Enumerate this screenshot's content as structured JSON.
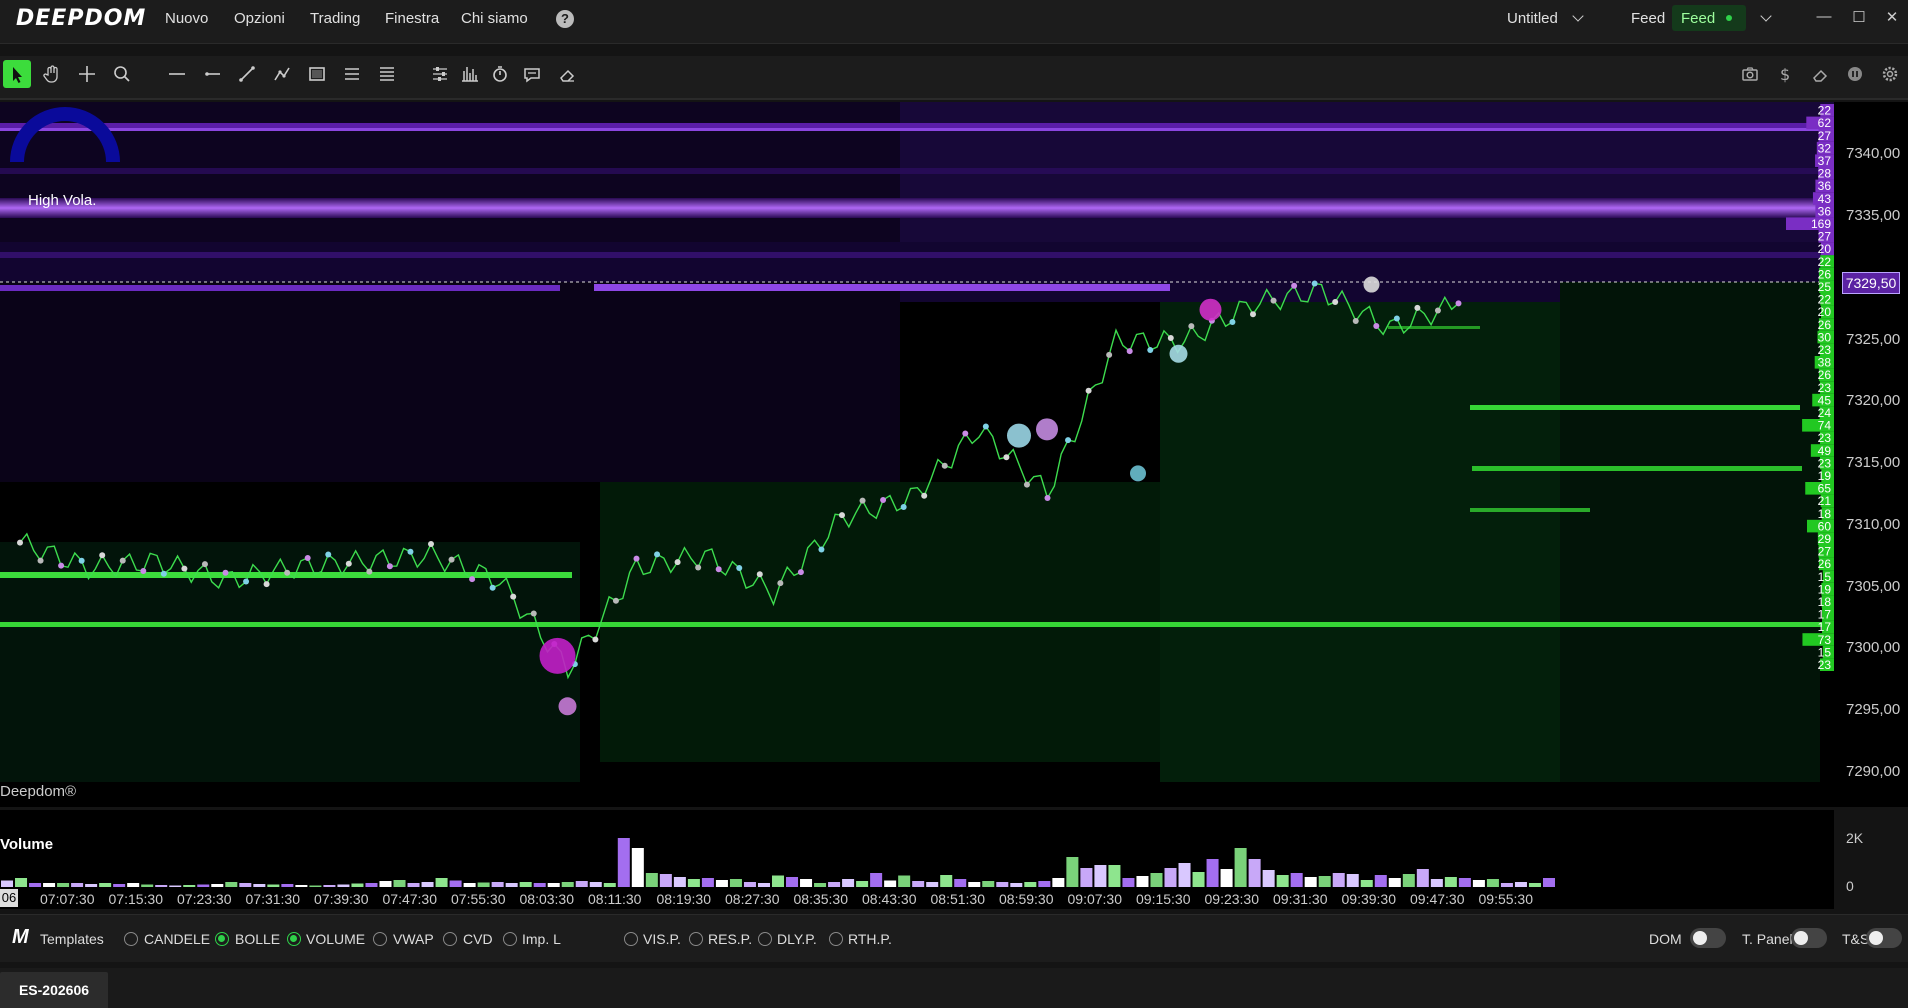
{
  "app": {
    "logo": "DEEPDOM"
  },
  "menu": {
    "items": [
      "Nuovo",
      "Opzioni",
      "Trading",
      "Finestra",
      "Chi siamo"
    ],
    "help": "?"
  },
  "header": {
    "workspace": "Untitled",
    "feed_label": "Feed",
    "feed_status": "Feed",
    "feed_status_color": "#2fd14a"
  },
  "window_controls": {
    "minimize": "—",
    "maximize": "☐",
    "close": "✕"
  },
  "toolbar": {
    "left_tools": [
      "pointer-icon",
      "hand-icon",
      "crosshair-icon",
      "magnifier-icon",
      "horizontal-line-icon",
      "horizontal-ray-icon",
      "trend-line-icon",
      "polyline-icon",
      "rectangle-icon",
      "parallel-lines-icon",
      "fib-lines-icon",
      "settings-sliders-icon",
      "histogram-icon",
      "timer-icon",
      "comment-icon",
      "eraser-icon"
    ],
    "right_tools": [
      "camera-icon",
      "dollar-icon",
      "eraser-icon",
      "pause-icon",
      "gear-icon"
    ],
    "active_tool": "pointer-icon"
  },
  "chart": {
    "gauge_label": "High Vola.",
    "watermark": "Deepdom®",
    "current_price": "7329,50",
    "price_axis": [
      "7340,00",
      "7335,00",
      "7330,00",
      "7325,00",
      "7320,00",
      "7315,00",
      "7310,00",
      "7305,00",
      "7300,00",
      "7295,00",
      "7290,00"
    ],
    "ask_sizes": [
      "22",
      "62",
      "27",
      "32",
      "37",
      "28",
      "36",
      "43",
      "36",
      "169",
      "27",
      "20"
    ],
    "bid_sizes": [
      "22",
      "26",
      "25",
      "22",
      "20",
      "26",
      "30",
      "23",
      "38",
      "26",
      "23",
      "45",
      "24",
      "74",
      "23",
      "49",
      "23",
      "19",
      "65",
      "21",
      "18",
      "60",
      "29",
      "27",
      "26",
      "15",
      "19",
      "18",
      "17",
      "17",
      "73",
      "15",
      "23"
    ],
    "colors": {
      "ask": "#7a2ec4",
      "bid": "#22c822",
      "price_line": "#3ddc4e"
    }
  },
  "chart_data": {
    "type": "line",
    "x": [
      "07:07:30",
      "07:15:30",
      "07:23:30",
      "07:31:30",
      "07:39:30",
      "07:47:30",
      "07:55:30",
      "08:03:30",
      "08:11:30",
      "08:19:30",
      "08:27:30",
      "08:35:30",
      "08:43:30",
      "08:51:30",
      "08:59:30",
      "09:07:30",
      "09:15:30",
      "09:23:30",
      "09:31:30",
      "09:39:30",
      "09:47:30",
      "09:55:30"
    ],
    "series": [
      {
        "values": [
          7309,
          7307,
          7307.5,
          7306,
          7307,
          7307.5,
          7308,
          7306,
          7299,
          7307,
          7308,
          7305,
          7311,
          7312.5,
          7318,
          7313,
          7325,
          7325,
          7328,
          7329,
          7326,
          7328
        ]
      }
    ],
    "ylim": [
      7288,
      7344
    ]
  },
  "volume": {
    "title": "Volume",
    "axis": [
      "2K",
      "0"
    ],
    "values": [
      0.15,
      0.2,
      0.1,
      0.1,
      0.1,
      0.1,
      0.08,
      0.1,
      0.08,
      0.1,
      0.07,
      0.06,
      0.05,
      0.06,
      0.07,
      0.08,
      0.12,
      0.1,
      0.08,
      0.07,
      0.08,
      0.06,
      0.05,
      0.06,
      0.07,
      0.09,
      0.1,
      0.14,
      0.16,
      0.1,
      0.12,
      0.2,
      0.15,
      0.1,
      0.11,
      0.12,
      0.1,
      0.12,
      0.1,
      0.1,
      0.12,
      0.14,
      0.12,
      0.1,
      1.0,
      0.8,
      0.3,
      0.28,
      0.22,
      0.18,
      0.2,
      0.16,
      0.18,
      0.12,
      0.1,
      0.25,
      0.22,
      0.18,
      0.1,
      0.12,
      0.18,
      0.14,
      0.3,
      0.15,
      0.25,
      0.14,
      0.12,
      0.26,
      0.18,
      0.12,
      0.14,
      0.12,
      0.1,
      0.12,
      0.14,
      0.2,
      0.62,
      0.4,
      0.46,
      0.46,
      0.2,
      0.24,
      0.3,
      0.4,
      0.5,
      0.32,
      0.58,
      0.38,
      0.8,
      0.58,
      0.36,
      0.26,
      0.3,
      0.22,
      0.24,
      0.3,
      0.28,
      0.16,
      0.26,
      0.2,
      0.28,
      0.38,
      0.18,
      0.22,
      0.2,
      0.16,
      0.18,
      0.1,
      0.12,
      0.1,
      0.2
    ],
    "colors": [
      "#d9c8ff",
      "#8ee58e",
      "#a36ef0",
      "#ffffff",
      "#7ad27a",
      "#c8a8f8"
    ]
  },
  "bottom": {
    "templates_label": "Templates",
    "options": [
      {
        "label": "CANDELE",
        "on": false
      },
      {
        "label": "BOLLE",
        "on": true
      },
      {
        "label": "VOLUME",
        "on": true
      },
      {
        "label": "VWAP",
        "on": false
      },
      {
        "label": "CVD",
        "on": false
      },
      {
        "label": "Imp. L",
        "on": false
      }
    ],
    "profiles": [
      {
        "label": "VIS.P.",
        "on": false
      },
      {
        "label": "RES.P.",
        "on": false
      },
      {
        "label": "DLY.P.",
        "on": false
      },
      {
        "label": "RTH.P.",
        "on": false
      }
    ],
    "toggles": [
      {
        "label": "DOM",
        "on": false
      },
      {
        "label": "T. Panel",
        "on": false
      },
      {
        "label": "T&S",
        "on": false
      }
    ]
  },
  "tabs": [
    {
      "label": "ES-202606"
    }
  ]
}
